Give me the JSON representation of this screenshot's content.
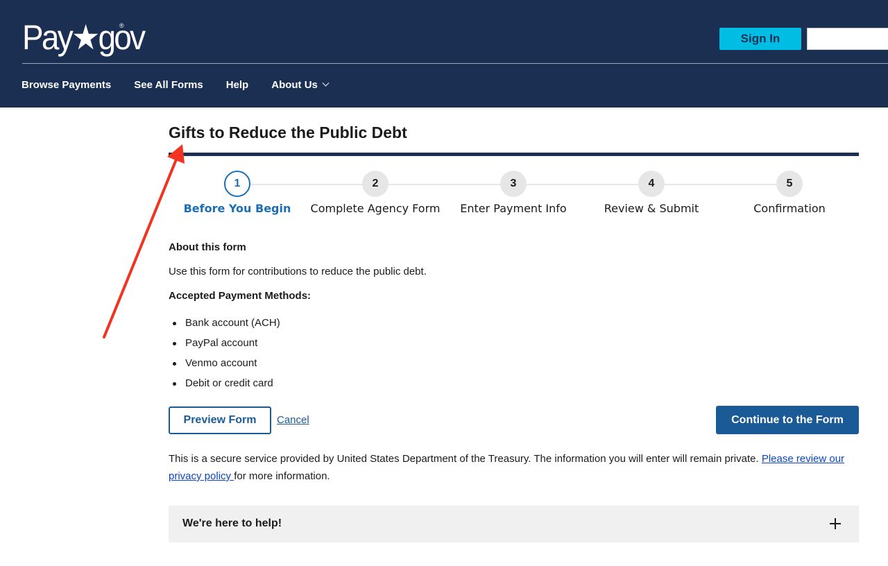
{
  "header": {
    "logo_text": "Pay★gov",
    "logo_reg": "®",
    "signin_label": "Sign In",
    "search_value": "",
    "nav": [
      {
        "label": "Browse Payments"
      },
      {
        "label": "See All Forms"
      },
      {
        "label": "Help"
      },
      {
        "label": "About Us",
        "has_dropdown": true
      }
    ]
  },
  "page": {
    "title": "Gifts to Reduce the Public Debt",
    "steps": [
      {
        "number": "1",
        "label": "Before You Begin",
        "active": true
      },
      {
        "number": "2",
        "label": "Complete Agency Form",
        "active": false
      },
      {
        "number": "3",
        "label": "Enter Payment Info",
        "active": false
      },
      {
        "number": "4",
        "label": "Review & Submit",
        "active": false
      },
      {
        "number": "5",
        "label": "Confirmation",
        "active": false
      }
    ],
    "about_heading": "About this form",
    "about_text": "Use this form for contributions to reduce the public debt.",
    "methods_heading": "Accepted Payment Methods:",
    "methods": [
      "Bank account (ACH)",
      "PayPal account",
      "Venmo account",
      "Debit or credit card"
    ],
    "preview_label": "Preview Form",
    "cancel_label": "Cancel",
    "continue_label": "Continue to the Form",
    "secure_text": "This is a secure service provided by United States Department of the Treasury. The information you will enter will remain private. ",
    "privacy_link": "Please review our privacy policy ",
    "secure_suffix": "for more information.",
    "help_title": "We're here to help!"
  },
  "colors": {
    "header_bg": "#1a2f52",
    "accent": "#1a5a96",
    "signin_bg": "#00bde3",
    "annotation": "#f2331f"
  }
}
